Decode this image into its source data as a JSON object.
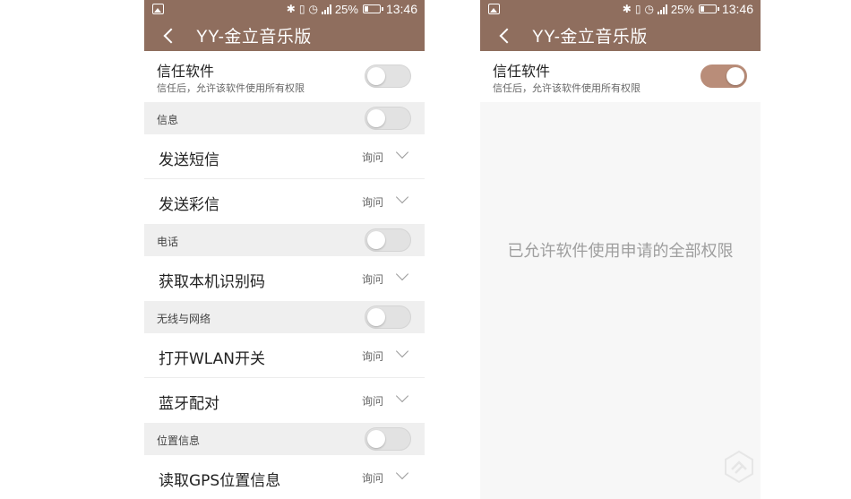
{
  "colors": {
    "accent": "#8f6e5e",
    "toggle_on": "#b98d79"
  },
  "status": {
    "battery": "25%",
    "time": "13:46"
  },
  "header": {
    "title": "YY-金立音乐版"
  },
  "trust": {
    "title": "信任软件",
    "subtitle": "信任后，允许该软件使用所有权限"
  },
  "left": {
    "trust_on": false,
    "sections": [
      {
        "label": "信息",
        "items": [
          {
            "name": "发送短信",
            "value": "询问"
          },
          {
            "name": "发送彩信",
            "value": "询问"
          }
        ]
      },
      {
        "label": "电话",
        "items": [
          {
            "name": "获取本机识别码",
            "value": "询问"
          }
        ]
      },
      {
        "label": "无线与网络",
        "items": [
          {
            "name": "打开WLAN开关",
            "value": "询问"
          },
          {
            "name": "蓝牙配对",
            "value": "询问"
          }
        ]
      },
      {
        "label": "位置信息",
        "items": [
          {
            "name": "读取GPS位置信息",
            "value": "询问"
          }
        ]
      }
    ]
  },
  "right": {
    "trust_on": true,
    "message": "已允许软件使用申请的全部权限"
  }
}
